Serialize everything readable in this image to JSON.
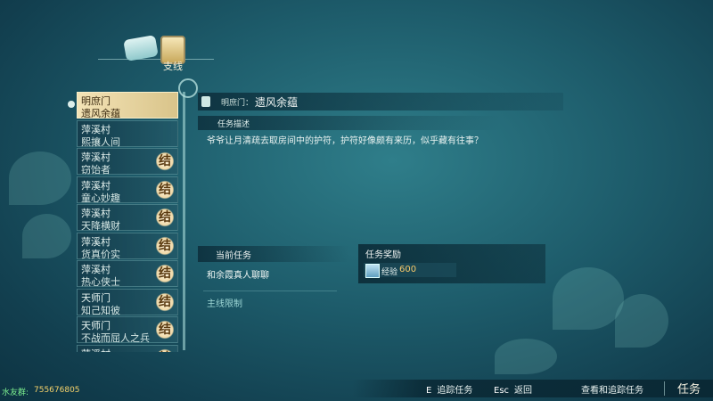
{
  "header": {
    "tab_label": "支线",
    "icons": [
      "scroll-icon",
      "branch-quest-icon"
    ]
  },
  "quest_list": [
    {
      "sect": "明庶门",
      "name": "遗风余蕴",
      "selected": true,
      "badge": ""
    },
    {
      "sect": "萍溪村",
      "name": "熙攘人间",
      "selected": false,
      "badge": ""
    },
    {
      "sect": "萍溪村",
      "name": "窃饴者",
      "selected": false,
      "badge": "结"
    },
    {
      "sect": "萍溪村",
      "name": "童心妙趣",
      "selected": false,
      "badge": "结"
    },
    {
      "sect": "萍溪村",
      "name": "天降横财",
      "selected": false,
      "badge": "结"
    },
    {
      "sect": "萍溪村",
      "name": "货真价实",
      "selected": false,
      "badge": "结"
    },
    {
      "sect": "萍溪村",
      "name": "热心侠士",
      "selected": false,
      "badge": "结"
    },
    {
      "sect": "天师门",
      "name": "知己知彼",
      "selected": false,
      "badge": "结"
    },
    {
      "sect": "天师门",
      "name": "不战而屈人之兵",
      "selected": false,
      "badge": "结"
    },
    {
      "sect": "萍溪村",
      "name": "",
      "selected": false,
      "badge": "结"
    }
  ],
  "detail": {
    "subtitle": "明庶门：",
    "title": "遗风余蕴",
    "desc_label": "任务描述",
    "description": "爷爷让月清疏去取房间中的护符，护符好像颇有来历，似乎藏有往事？",
    "current_label": "当前任务",
    "current_task": "和余霞真人聊聊",
    "main_limit": "主线限制",
    "reward_label": "任务奖励",
    "reward": {
      "icon": "exp-book-icon",
      "label": "经验",
      "value": "600"
    }
  },
  "bottom_bar": {
    "track_key": "E",
    "track_label": "追踪任务",
    "back_key": "Esc",
    "back_label": "返回",
    "view_label": "查看和追踪任务",
    "task_tab": "任务"
  },
  "watermark": {
    "label": "水友群:",
    "number": "755676805"
  }
}
